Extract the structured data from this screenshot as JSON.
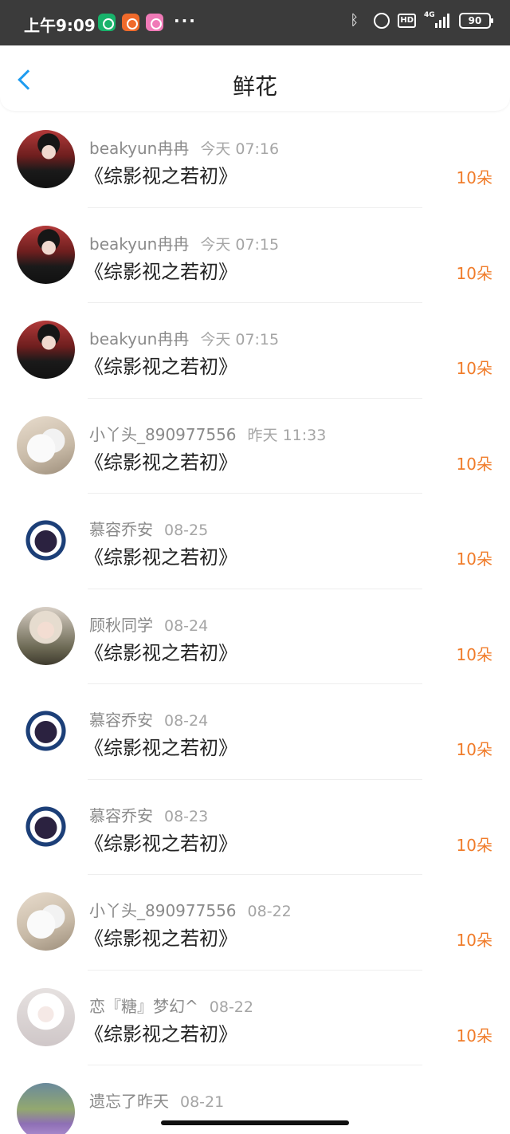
{
  "status_bar": {
    "time": "上午9:09",
    "dots": "···",
    "network": "4G",
    "battery": "90",
    "hd": "HD",
    "bluetooth": "ᛒ"
  },
  "header": {
    "title": "鲜花"
  },
  "records": [
    {
      "name": "beakyun冉冉",
      "time": "今天 07:16",
      "book": "《综影视之若初》",
      "amount": "10朵",
      "avatar": "boy"
    },
    {
      "name": "beakyun冉冉",
      "time": "今天 07:15",
      "book": "《综影视之若初》",
      "amount": "10朵",
      "avatar": "boy"
    },
    {
      "name": "beakyun冉冉",
      "time": "今天 07:15",
      "book": "《综影视之若初》",
      "amount": "10朵",
      "avatar": "boy"
    },
    {
      "name": "小丫头_890977556",
      "time": "昨天 11:33",
      "book": "《综影视之若初》",
      "amount": "10朵",
      "avatar": "cat"
    },
    {
      "name": "慕容乔安",
      "time": "08-25",
      "book": "《综影视之若初》",
      "amount": "10朵",
      "avatar": "bday"
    },
    {
      "name": "顾秋同学",
      "time": "08-24",
      "book": "《综影视之若初》",
      "amount": "10朵",
      "avatar": "girl"
    },
    {
      "name": "慕容乔安",
      "time": "08-24",
      "book": "《综影视之若初》",
      "amount": "10朵",
      "avatar": "bday"
    },
    {
      "name": "慕容乔安",
      "time": "08-23",
      "book": "《综影视之若初》",
      "amount": "10朵",
      "avatar": "bday"
    },
    {
      "name": "小丫头_890977556",
      "time": "08-22",
      "book": "《综影视之若初》",
      "amount": "10朵",
      "avatar": "cat"
    },
    {
      "name": "恋『糖』梦幻^",
      "time": "08-22",
      "book": "《综影视之若初》",
      "amount": "10朵",
      "avatar": "white"
    },
    {
      "name": "遗忘了昨天",
      "time": "08-21",
      "book": "",
      "amount": "",
      "avatar": "field"
    }
  ],
  "colors": {
    "accent": "#1e9cf0",
    "amount": "#f07c2a",
    "status_bar_bg": "#3b3b3b"
  }
}
